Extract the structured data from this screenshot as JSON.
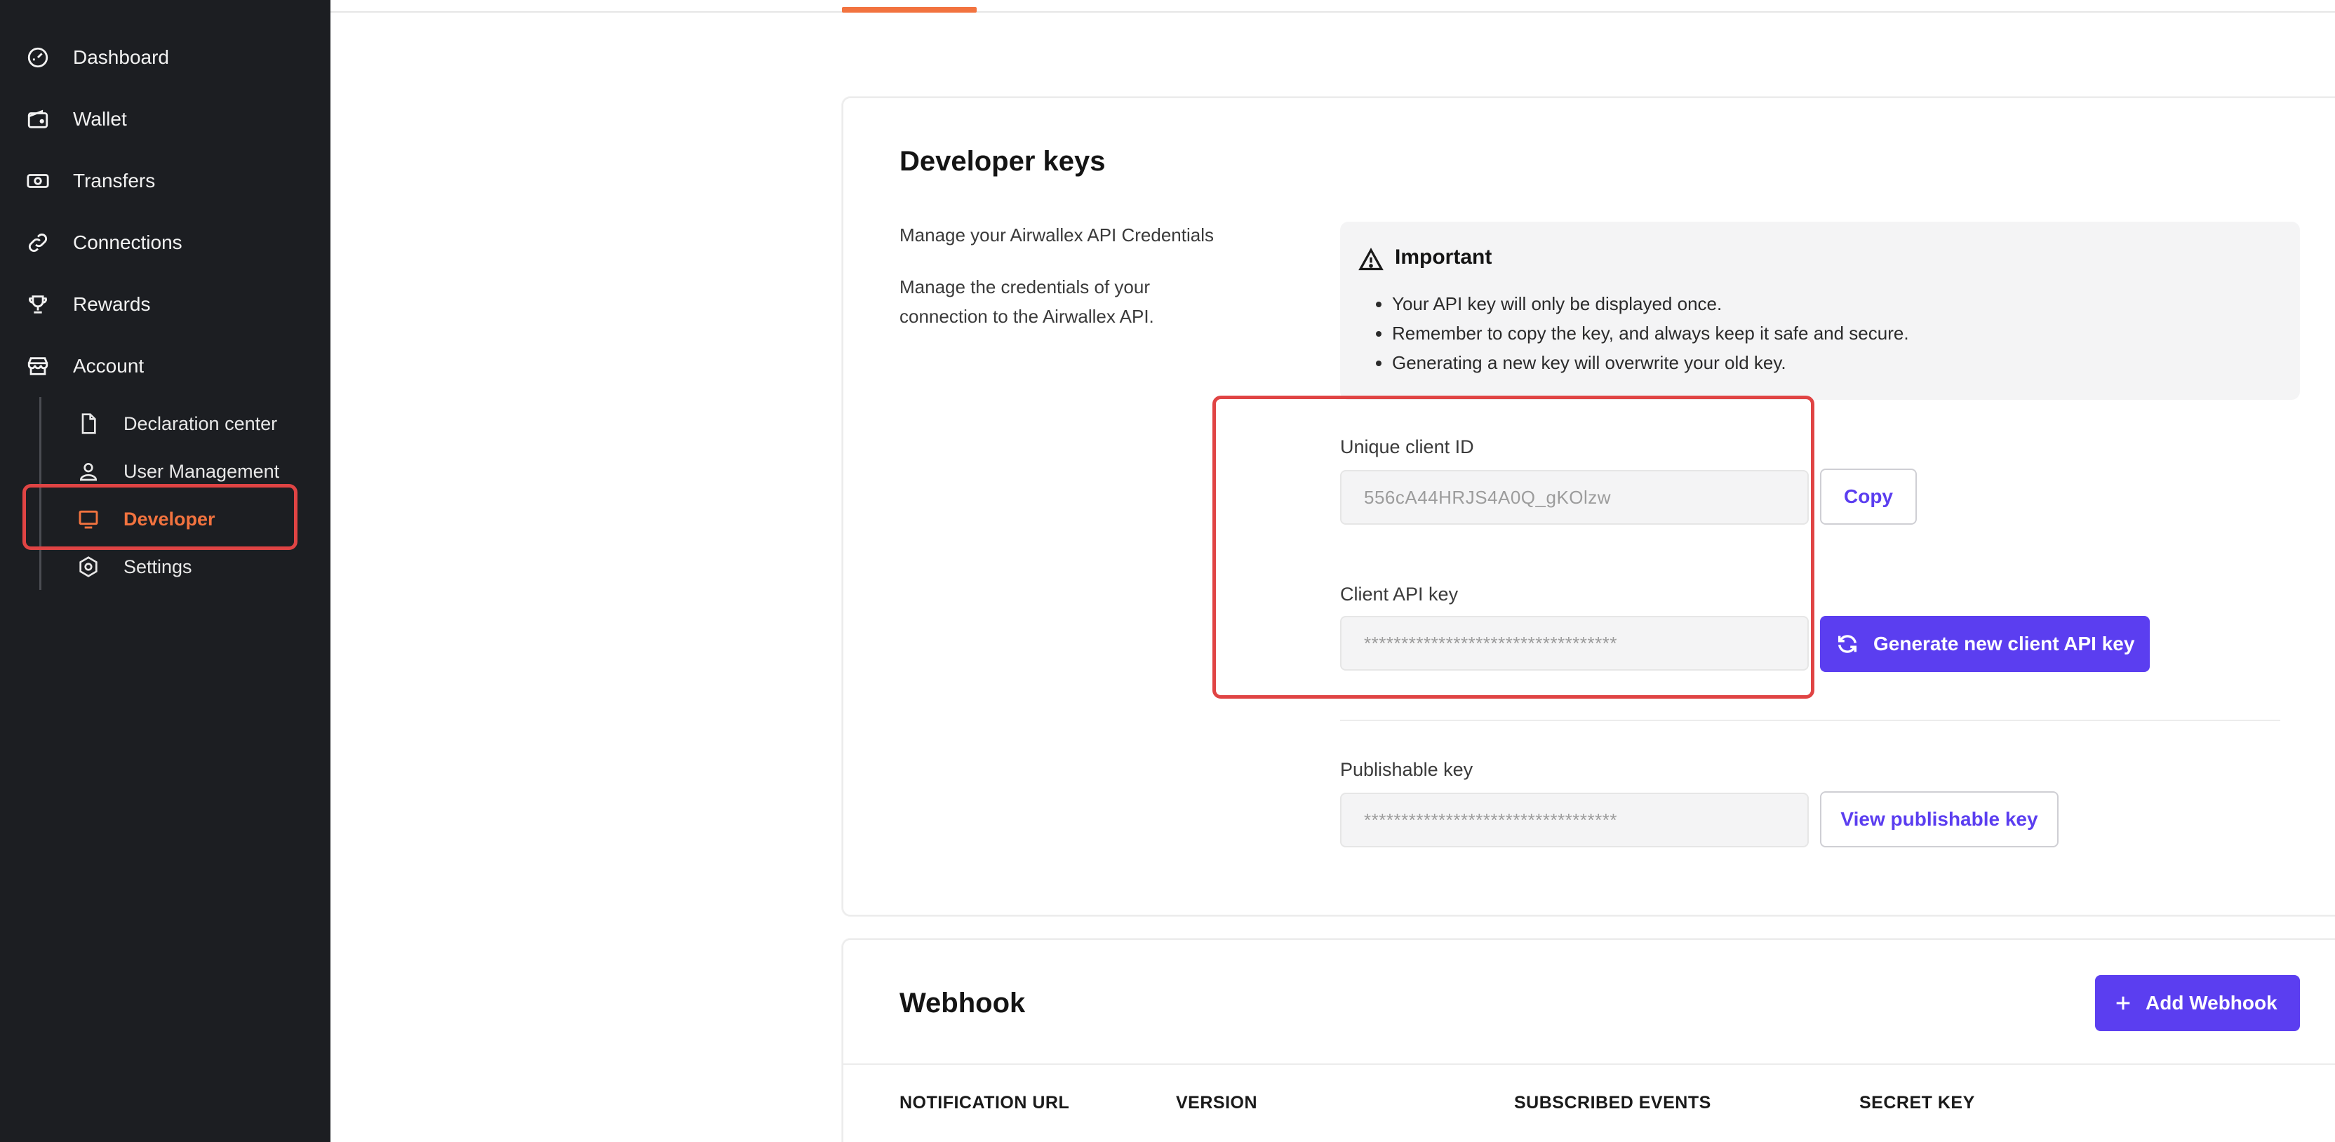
{
  "colors": {
    "sidebar_bg": "#1c1e22",
    "accent_orange": "#f2733f",
    "primary_purple": "#5b3ef0",
    "highlight_red": "#e04444"
  },
  "sidebar": {
    "items": [
      {
        "label": "Dashboard",
        "icon": "gauge-icon"
      },
      {
        "label": "Wallet",
        "icon": "wallet-icon"
      },
      {
        "label": "Transfers",
        "icon": "cash-icon"
      },
      {
        "label": "Connections",
        "icon": "link-icon"
      },
      {
        "label": "Rewards",
        "icon": "trophy-icon"
      },
      {
        "label": "Account",
        "icon": "store-icon"
      }
    ],
    "sub_items": [
      {
        "label": "Declaration center",
        "icon": "document-icon"
      },
      {
        "label": "User Management",
        "icon": "user-icon"
      },
      {
        "label": "Developer",
        "icon": "monitor-icon",
        "active": true
      },
      {
        "label": "Settings",
        "icon": "gear-icon"
      }
    ]
  },
  "developer_keys": {
    "title": "Developer keys",
    "desc_1": "Manage your Airwallex API Credentials",
    "desc_2_line1": "Manage the credentials of your",
    "desc_2_line2": "connection to the Airwallex API.",
    "notice": {
      "title": "Important",
      "icon": "warning-icon",
      "items": [
        "Your API key will only be displayed once.",
        "Remember to copy the key, and always keep it safe and secure.",
        "Generating a new key will overwrite your old key."
      ]
    },
    "client_id": {
      "label": "Unique client ID",
      "value": "556cA44HRJS4A0Q_gKOlzw",
      "copy_label": "Copy"
    },
    "api_key": {
      "label": "Client API key",
      "value": "**********************************",
      "generate_label": "Generate new client API key",
      "generate_icon": "refresh-icon"
    },
    "publishable_key": {
      "label": "Publishable key",
      "value": "**********************************",
      "view_label": "View publishable key"
    }
  },
  "webhook": {
    "title": "Webhook",
    "add_label": "Add Webhook",
    "add_icon": "plus-icon",
    "columns": [
      "NOTIFICATION URL",
      "VERSION",
      "SUBSCRIBED EVENTS",
      "SECRET KEY"
    ]
  }
}
